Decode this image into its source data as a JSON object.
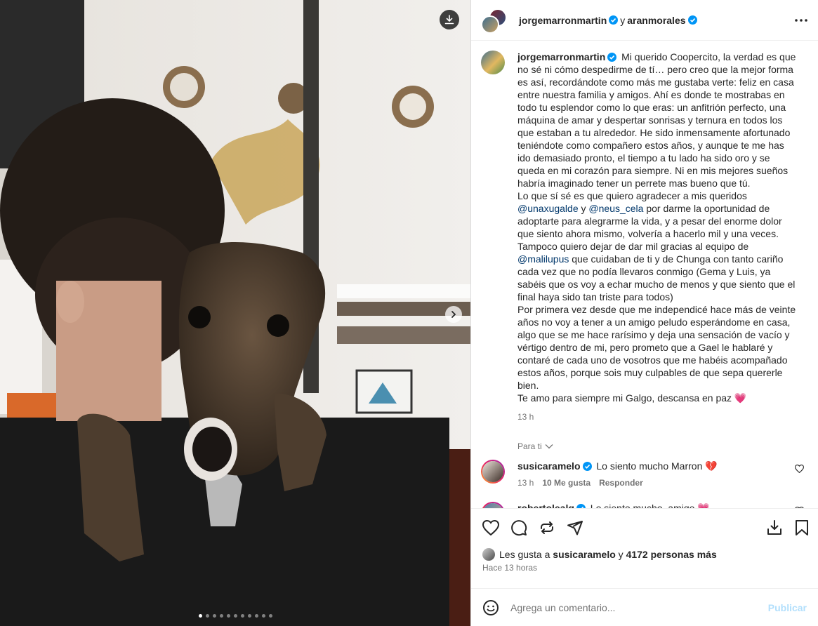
{
  "header": {
    "user1": "jorgemarronmartin",
    "and": "y",
    "user2": "aranmorales"
  },
  "caption": {
    "author": "jorgemarronmartin",
    "para1_text": "Mi querido Coopercito, la verdad es que no sé ni cómo despedirme de tí… pero creo que la mejor forma es así, recordándote como más me gustaba verte: feliz en casa entre nuestra familia y amigos. Ahí es donde te mostrabas en todo tu esplendor como lo que eras: un anfitrión perfecto, una máquina de amar y despertar sonrisas y ternura en todos los que estaban a tu alrededor. He sido inmensamente afortunado teniéndote como compañero estos años, y aunque te me has ido demasiado pronto, el tiempo a tu lado ha sido oro y se queda en mi corazón para siempre. Ni en mis mejores sueños habría imaginado tener un perrete mas bueno que tú.",
    "para2_a": "Lo que sí sé es que quiero agradecer a mis queridos",
    "mention1": "@unaxugalde",
    "para2_b": "y",
    "mention2": "@neus_cela",
    "para2_c": "por darme la oportunidad de adoptarte para alegrarme la vida, y a pesar del enorme dolor que siento ahora mismo, volvería a hacerlo mil y una veces. Tampoco quiero dejar de dar mil gracias al equipo de",
    "mention3": "@malilupus",
    "para2_d": "que cuidaban de ti y de Chunga con tanto cariño cada vez que no podía llevaros conmigo (Gema y Luis, ya sabéis que os voy a echar mucho de menos y que siento que el final haya sido tan triste para todos)",
    "para3": "Por primera vez desde que me independicé hace más de veinte años no voy a tener a un amigo peludo esperándome en casa, algo que se me hace rarísimo y deja una sensación de vacío y vértigo dentro de mi, pero prometo que a Gael le hablaré y contaré de cada uno de vosotros que me habéis acompañado estos años, porque sois muy culpables de que sepa quererle bien.",
    "para4": "Te amo para siempre mi Galgo, descansa en paz 💗",
    "time": "13 h"
  },
  "translate_label": "Para ti",
  "comments": [
    {
      "user": "susicaramelo",
      "text": "Lo siento mucho Marron 💔",
      "time": "13 h",
      "likes": "10 Me gusta",
      "reply": "Responder"
    },
    {
      "user": "robertolealg",
      "text": "Lo siento mucho, amigo 💗"
    }
  ],
  "likes": {
    "prefix": "Les gusta a",
    "user": "susicaramelo",
    "middle": "y",
    "others": "4172 personas más"
  },
  "posted_ago": "Hace 13 horas",
  "add_comment": {
    "placeholder": "Agrega un comentario...",
    "publish": "Publicar"
  },
  "carousel": {
    "total": 11,
    "active_index": 0
  },
  "colors": {
    "verified": "#0095f6",
    "mention": "#00376b",
    "publish": "#b2dffc",
    "heart": "#ed4956"
  }
}
